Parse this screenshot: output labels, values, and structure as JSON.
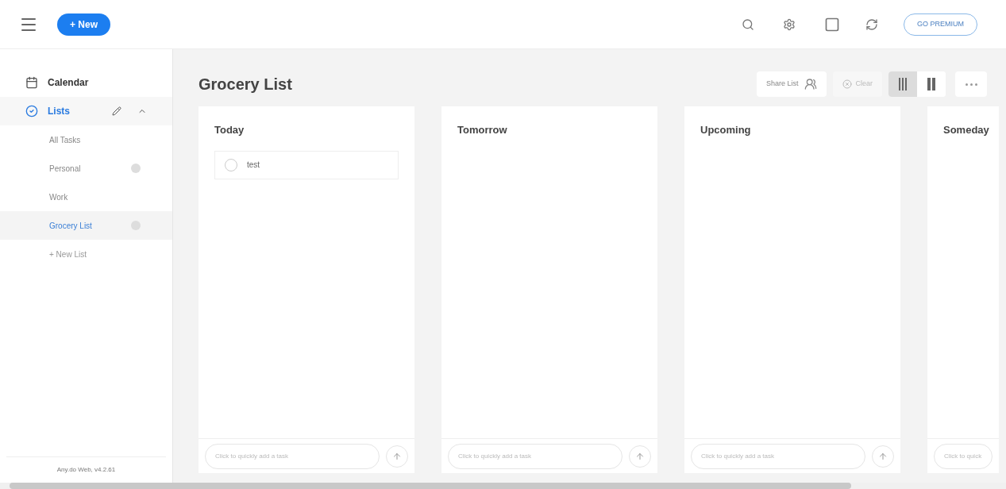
{
  "header": {
    "new_button": "+ New",
    "premium_button": "GO PREMIUM"
  },
  "sidebar": {
    "calendar": "Calendar",
    "lists": {
      "label": "Lists",
      "expanded": true,
      "selected": false
    },
    "items": [
      {
        "label": "All Tasks",
        "selected": false,
        "badge": false
      },
      {
        "label": "Personal",
        "selected": false,
        "badge": true
      },
      {
        "label": "Work",
        "selected": false,
        "badge": false
      },
      {
        "label": "Grocery List",
        "selected": true,
        "badge": true
      }
    ],
    "new_list": "+ New List",
    "footer": "Any.do Web, v4.2.61"
  },
  "board": {
    "title": "Grocery List",
    "share_button": "Share List",
    "clear_button": {
      "label": "Clear",
      "disabled": true
    },
    "views": [
      {
        "kind": "three",
        "selected": true
      },
      {
        "kind": "two",
        "selected": false
      }
    ],
    "columns": [
      {
        "title": "Today",
        "tasks": [
          {
            "label": "test",
            "checked": false
          }
        ],
        "placeholder": "Click to quickly add a task"
      },
      {
        "title": "Tomorrow",
        "placeholder": "Click to quickly add a task"
      },
      {
        "title": "Upcoming",
        "placeholder": "Click to quickly add a task"
      },
      {
        "title": "Someday",
        "placeholder": "Click to quick"
      }
    ]
  }
}
